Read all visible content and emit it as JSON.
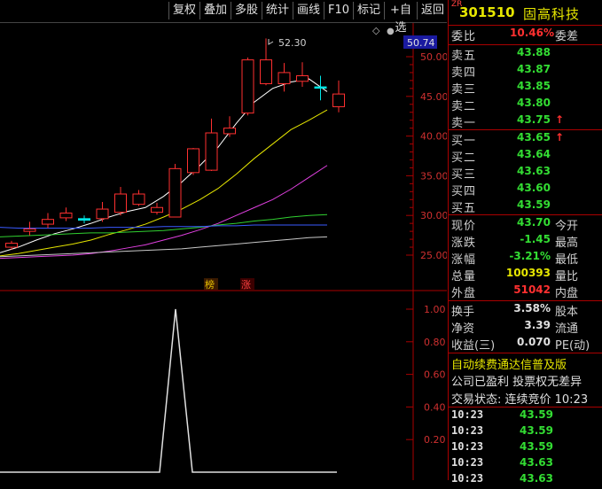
{
  "toolbar": {
    "buttons": [
      "复权",
      "叠加",
      "多股",
      "统计",
      "画线",
      "F10",
      "标记",
      "+自选",
      "返回"
    ]
  },
  "chart": {
    "price_axis": [
      "50.00",
      "45.00",
      "40.00",
      "35.00",
      "30.00",
      "25.00"
    ],
    "current_price_tag": "50.74",
    "high_label": "52.30",
    "indicator_axis": [
      "1.00",
      "0.80",
      "0.60",
      "0.40",
      "0.20"
    ],
    "markers": [
      "榜",
      "涨"
    ]
  },
  "chart_data": {
    "type": "candlestick",
    "candles": [
      {
        "o": 26.0,
        "c": 26.5,
        "h": 26.8,
        "l": 25.7
      },
      {
        "o": 28.0,
        "c": 28.3,
        "h": 29.2,
        "l": 27.5
      },
      {
        "o": 28.9,
        "c": 29.5,
        "h": 30.3,
        "l": 28.4
      },
      {
        "o": 29.7,
        "c": 30.3,
        "h": 31.0,
        "l": 29.3
      },
      {
        "o": 29.6,
        "c": 29.4,
        "h": 30.0,
        "l": 29.0
      },
      {
        "o": 29.6,
        "c": 30.8,
        "h": 31.7,
        "l": 29.2
      },
      {
        "o": 30.4,
        "c": 32.7,
        "h": 33.6,
        "l": 30.0
      },
      {
        "o": 31.4,
        "c": 32.7,
        "h": 33.2,
        "l": 31.2
      },
      {
        "o": 30.4,
        "c": 31.0,
        "h": 31.6,
        "l": 30.1
      },
      {
        "o": 29.8,
        "c": 35.9,
        "h": 36.5,
        "l": 29.8
      },
      {
        "o": 35.4,
        "c": 38.4,
        "h": 38.5,
        "l": 35.1
      },
      {
        "o": 35.7,
        "c": 40.4,
        "h": 42.2,
        "l": 35.6
      },
      {
        "o": 40.3,
        "c": 41.0,
        "h": 42.5,
        "l": 39.9
      },
      {
        "o": 42.9,
        "c": 49.6,
        "h": 49.9,
        "l": 42.6
      },
      {
        "o": 46.6,
        "c": 49.6,
        "h": 52.3,
        "l": 46.4
      },
      {
        "o": 46.6,
        "c": 48.0,
        "h": 49.2,
        "l": 45.6
      },
      {
        "o": 46.9,
        "c": 47.6,
        "h": 49.3,
        "l": 46.2
      },
      {
        "o": 46.2,
        "c": 46.1,
        "h": 47.6,
        "l": 44.5
      },
      {
        "o": 43.7,
        "c": 45.3,
        "h": 47.0,
        "l": 43.0
      }
    ],
    "ylim": [
      23,
      54
    ]
  },
  "quote": {
    "code": "301510",
    "name": "固高科技",
    "tag": "ZR",
    "weibi_label": "委比",
    "weibi_value": "10.46%",
    "weicha_label": "委差",
    "asks": [
      {
        "label": "卖五",
        "price": "43.88"
      },
      {
        "label": "卖四",
        "price": "43.87"
      },
      {
        "label": "卖三",
        "price": "43.85"
      },
      {
        "label": "卖二",
        "price": "43.80"
      },
      {
        "label": "卖一",
        "price": "43.75"
      }
    ],
    "bids": [
      {
        "label": "买一",
        "price": "43.65"
      },
      {
        "label": "买二",
        "price": "43.64"
      },
      {
        "label": "买三",
        "price": "43.63"
      },
      {
        "label": "买四",
        "price": "43.60"
      },
      {
        "label": "买五",
        "price": "43.59"
      }
    ],
    "stats": [
      {
        "l1": "现价",
        "v": "43.70",
        "l2": "今开",
        "cls": "green"
      },
      {
        "l1": "涨跌",
        "v": "-1.45",
        "l2": "最高",
        "cls": "green"
      },
      {
        "l1": "涨幅",
        "v": "-3.21%",
        "l2": "最低",
        "cls": "green"
      },
      {
        "l1": "总量",
        "v": "100393",
        "l2": "量比",
        "cls": "yellow"
      },
      {
        "l1": "外盘",
        "v": "51042",
        "l2": "内盘",
        "cls": "red"
      }
    ],
    "stats2": [
      {
        "l1": "换手",
        "v": "3.58%",
        "l2": "股本"
      },
      {
        "l1": "净资",
        "v": "3.39",
        "l2": "流通"
      },
      {
        "l1": "收益(三)",
        "v": "0.070",
        "l2": "PE(动)"
      }
    ],
    "ticker1": "自动续费通达信普及版",
    "ticker2": "公司已盈利 投票权无差异",
    "trade_status": "交易状态: 连续竞价 10:23",
    "ticks": [
      {
        "t": "10:23",
        "p": "43.59"
      },
      {
        "t": "10:23",
        "p": "43.59"
      },
      {
        "t": "10:23",
        "p": "43.59"
      },
      {
        "t": "10:23",
        "p": "43.63"
      },
      {
        "t": "10:23",
        "p": "43.63"
      }
    ]
  }
}
